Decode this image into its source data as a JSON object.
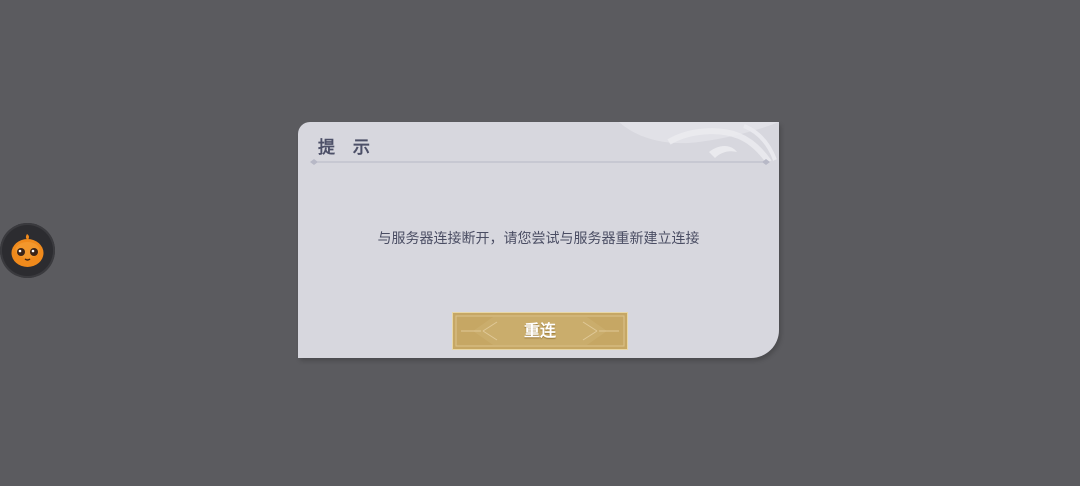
{
  "dialog": {
    "title": "提 示",
    "message": "与服务器连接断开，请您尝试与服务器重新建立连接",
    "button_label": "重连"
  },
  "colors": {
    "background": "#5b5b5f",
    "dialog_bg": "#d7d7de",
    "title_text": "#4d5068",
    "button_gold": "#c6a764",
    "float_icon_orange": "#f08a1c"
  },
  "icons": {
    "float_button": "orange-mascot-icon"
  }
}
